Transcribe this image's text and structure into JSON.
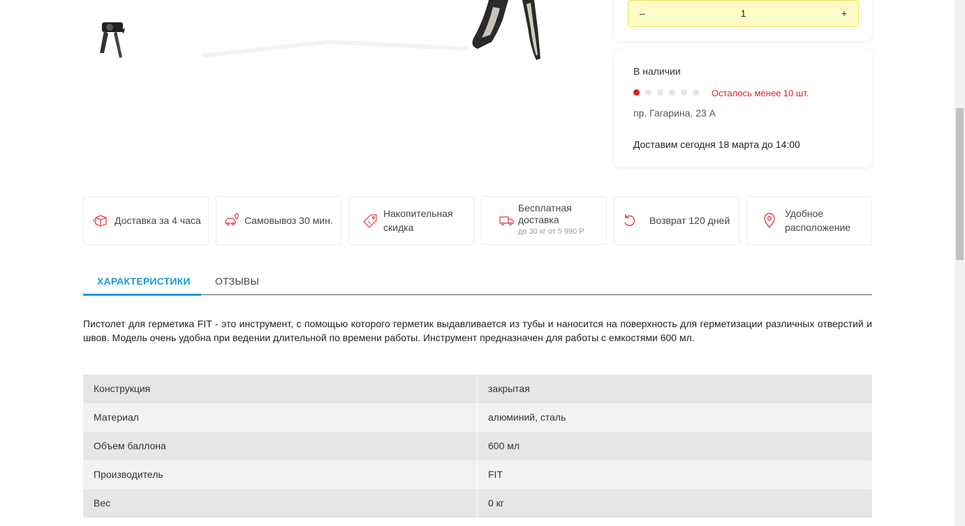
{
  "quantity": {
    "minus": "–",
    "value": "1",
    "plus": "+"
  },
  "stock": {
    "title": "В наличии",
    "level_filled": 1,
    "level_total": 6,
    "remaining": "Осталось менее 10 шт.",
    "address": "пр. Гагарина, 23 А",
    "delivery": "Доставим сегодня 18 марта до 14:00"
  },
  "features": [
    {
      "icon": "box-icon",
      "label": "Доставка за 4 часа",
      "sub": ""
    },
    {
      "icon": "car-pin-icon",
      "label": "Самовывоз 30 мин.",
      "sub": ""
    },
    {
      "icon": "tag-icon",
      "label": "Накопительная скидка",
      "sub": ""
    },
    {
      "icon": "truck-icon",
      "label": "Бесплатная доставка",
      "sub": "до 30 кг от 5 990 Р"
    },
    {
      "icon": "return-icon",
      "label": "Возврат 120 дней",
      "sub": ""
    },
    {
      "icon": "location-pin-icon",
      "label": "Удобное расположение",
      "sub": ""
    }
  ],
  "tabs": [
    {
      "label": "ХАРАКТЕРИСТИКИ",
      "active": true
    },
    {
      "label": "ОТЗЫВЫ",
      "active": false
    }
  ],
  "description": "Пистолет для герметика FIT - это инструмент, с помощью которого герметик выдавливается из тубы и наносится на поверхность для герметизации различных отверстий и швов. Модель очень удобна при ведении длительной по времени работы. Инструмент предназначен для работы с емкостями 600 мл.",
  "specs": [
    {
      "key": "Конструкция",
      "value": "закрытая"
    },
    {
      "key": "Материал",
      "value": "алюминий, сталь"
    },
    {
      "key": "Объем баллона",
      "value": "600 мл"
    },
    {
      "key": "Производитель",
      "value": "FIT"
    },
    {
      "key": "Вес",
      "value": "0 кг"
    }
  ],
  "colors": {
    "accent": "#1a9ad6",
    "alert": "#e21e26",
    "qty_bg": "#fdfbc6",
    "icon": "#e0454a"
  }
}
